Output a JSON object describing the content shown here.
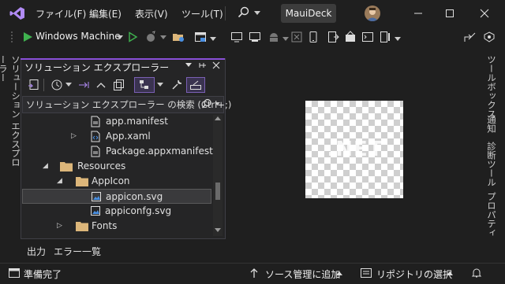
{
  "menu": {
    "file": "ファイル(F)",
    "edit": "編集(E)",
    "view": "表示(V)",
    "tools": "ツール(T)"
  },
  "solution_name": "MauiDeck",
  "toolbar": {
    "run_target": "Windows Machine"
  },
  "solution_explorer": {
    "title": "ソリューション エクスプローラー",
    "search_placeholder": "ソリューション エクスプローラー の検索 (Ctrl+;)",
    "tree": [
      {
        "label": "app.manifest",
        "type": "file"
      },
      {
        "label": "App.xaml",
        "type": "xaml",
        "expander": "collapsed"
      },
      {
        "label": "Package.appxmanifest",
        "type": "file"
      },
      {
        "label": "Resources",
        "type": "folder",
        "expander": "expanded"
      },
      {
        "label": "AppIcon",
        "type": "folder",
        "expander": "expanded"
      },
      {
        "label": "appicon.svg",
        "type": "image",
        "selected": true
      },
      {
        "label": "appiconfg.svg",
        "type": "image"
      },
      {
        "label": "Fonts",
        "type": "folder",
        "expander": "collapsed"
      }
    ]
  },
  "left_rail": {
    "label": "ソリューション エクスプローラー"
  },
  "right_rail": {
    "toolbox": "ツールボックス",
    "notifications": "通知",
    "diagnostics": "診断ツール",
    "properties": "プロパティ"
  },
  "editor": {
    "preview_text": ".NET"
  },
  "bottom_tabs": {
    "output": "出力",
    "error_list": "エラー一覧"
  },
  "status": {
    "ready": "準備完了",
    "add_to_source_control": "ソース管理に追加",
    "select_repository": "リポジトリの選択"
  },
  "colors": {
    "accent_purple": "#8a4fd8",
    "run_green": "#3fb24f",
    "background": "#1f1f1f"
  }
}
